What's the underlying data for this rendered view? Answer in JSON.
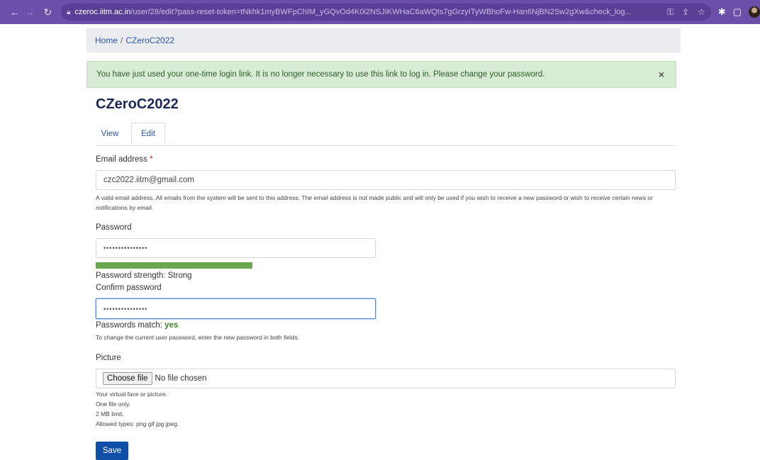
{
  "browser": {
    "url_host": "czeroc.iitm.ac.in",
    "url_path": "/user/28/edit?pass-reset-token=tNkhk1myBWFpChIM_yGQvOd4K0i2NSJIKWHaC6aWQts7gGrzyITyWBhoFw-Han6NjBN2Sw2gXw&check_log..."
  },
  "breadcrumb": {
    "home": "Home",
    "separator": "/",
    "current": "CZeroC2022"
  },
  "alert": {
    "message": "You have just used your one-time login link. It is no longer necessary to use this link to log in. Please change your password.",
    "close": "×"
  },
  "page_title": "CZeroC2022",
  "tabs": [
    {
      "label": "View"
    },
    {
      "label": "Edit"
    }
  ],
  "email": {
    "label": "Email address",
    "required": "*",
    "value": "czc2022.iitm@gmail.com",
    "help": "A valid email address. All emails from the system will be sent to this address. The email address is not made public and will only be used if you wish to receive a new password or wish to receive certain news or notifications by email."
  },
  "password": {
    "label": "Password",
    "value": "•••••••••••••••",
    "strength_label": "Password strength: Strong",
    "strength_fraction": 0.27
  },
  "confirm_password": {
    "label": "Confirm password",
    "value": "•••••••••••••••",
    "match_label": "Passwords match:",
    "match_value": "yes",
    "help": "To change the current user password, enter the new password in both fields."
  },
  "picture": {
    "label": "Picture",
    "button": "Choose file",
    "status": "No file chosen",
    "help_lines": [
      "Your virtual face or picture.",
      "One file only.",
      "2 MB limit.",
      "Allowed types: png gif jpg jpeg."
    ]
  },
  "save_label": "Save",
  "colors": {
    "browser_bar": "#6c4fa8",
    "accent": "#0f4fa8",
    "alert_bg": "#d8ecd5",
    "strength": "#6aa84f"
  }
}
